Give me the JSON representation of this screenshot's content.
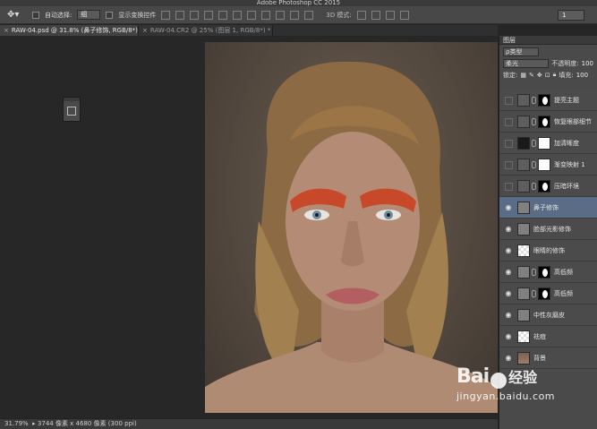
{
  "window": {
    "title": "Adobe Photoshop CC 2015"
  },
  "options_bar": {
    "auto_select_label": "自动选择:",
    "auto_select_value": "组",
    "show_transform_label": "显示变换控件",
    "mode_3d_label": "3D 模式:",
    "right_value": "1"
  },
  "tabs": [
    {
      "label": "RAW-04.psd @ 31.8% (鼻子修饰, RGB/8*) *"
    },
    {
      "label": "RAW-04.CR2 @ 25% (图层 1, RGB/8*) *"
    }
  ],
  "status_bar": {
    "zoom": "31.79%",
    "doc_info": "3744 像素 x 4680 像素 (300 ppi)"
  },
  "layers_panel": {
    "tab_label": "图层",
    "filter_label": "ρ类型",
    "blend_mode": "柔光",
    "opacity_label": "不透明度:",
    "opacity_value": "100",
    "lock_label": "锁定:",
    "fill_label": "填充:",
    "fill_value": "100",
    "layers": [
      {
        "name": "提亮主题",
        "visible": false,
        "thumb": "adj",
        "mask": "face"
      },
      {
        "name": "恢复眼部细节",
        "visible": false,
        "thumb": "adj",
        "mask": "face"
      },
      {
        "name": "加清晰度",
        "visible": false,
        "thumb": "dark",
        "mask": "w"
      },
      {
        "name": "渐变映射 1",
        "visible": false,
        "thumb": "adj",
        "mask": "w"
      },
      {
        "name": "压暗环境",
        "visible": false,
        "thumb": "adj",
        "mask": "face"
      },
      {
        "name": "鼻子修饰",
        "visible": true,
        "thumb": "gray",
        "mask": "",
        "selected": true
      },
      {
        "name": "脸部光影修饰",
        "visible": true,
        "thumb": "gray",
        "mask": ""
      },
      {
        "name": "眼睛的修饰",
        "visible": true,
        "thumb": "checker",
        "mask": ""
      },
      {
        "name": "高低频",
        "visible": true,
        "thumb": "gray",
        "mask": "face"
      },
      {
        "name": "高低频",
        "visible": true,
        "thumb": "gray",
        "mask": "face"
      },
      {
        "name": "中性灰磨皮",
        "visible": true,
        "thumb": "gray",
        "mask": ""
      },
      {
        "name": "祛痘",
        "visible": true,
        "thumb": "checker",
        "mask": ""
      },
      {
        "name": "背景",
        "visible": true,
        "thumb": "photo-t",
        "mask": ""
      }
    ]
  },
  "watermark": {
    "logo_left": "Bai",
    "logo_right": "经验",
    "url": "jingyan.baidu.com"
  }
}
